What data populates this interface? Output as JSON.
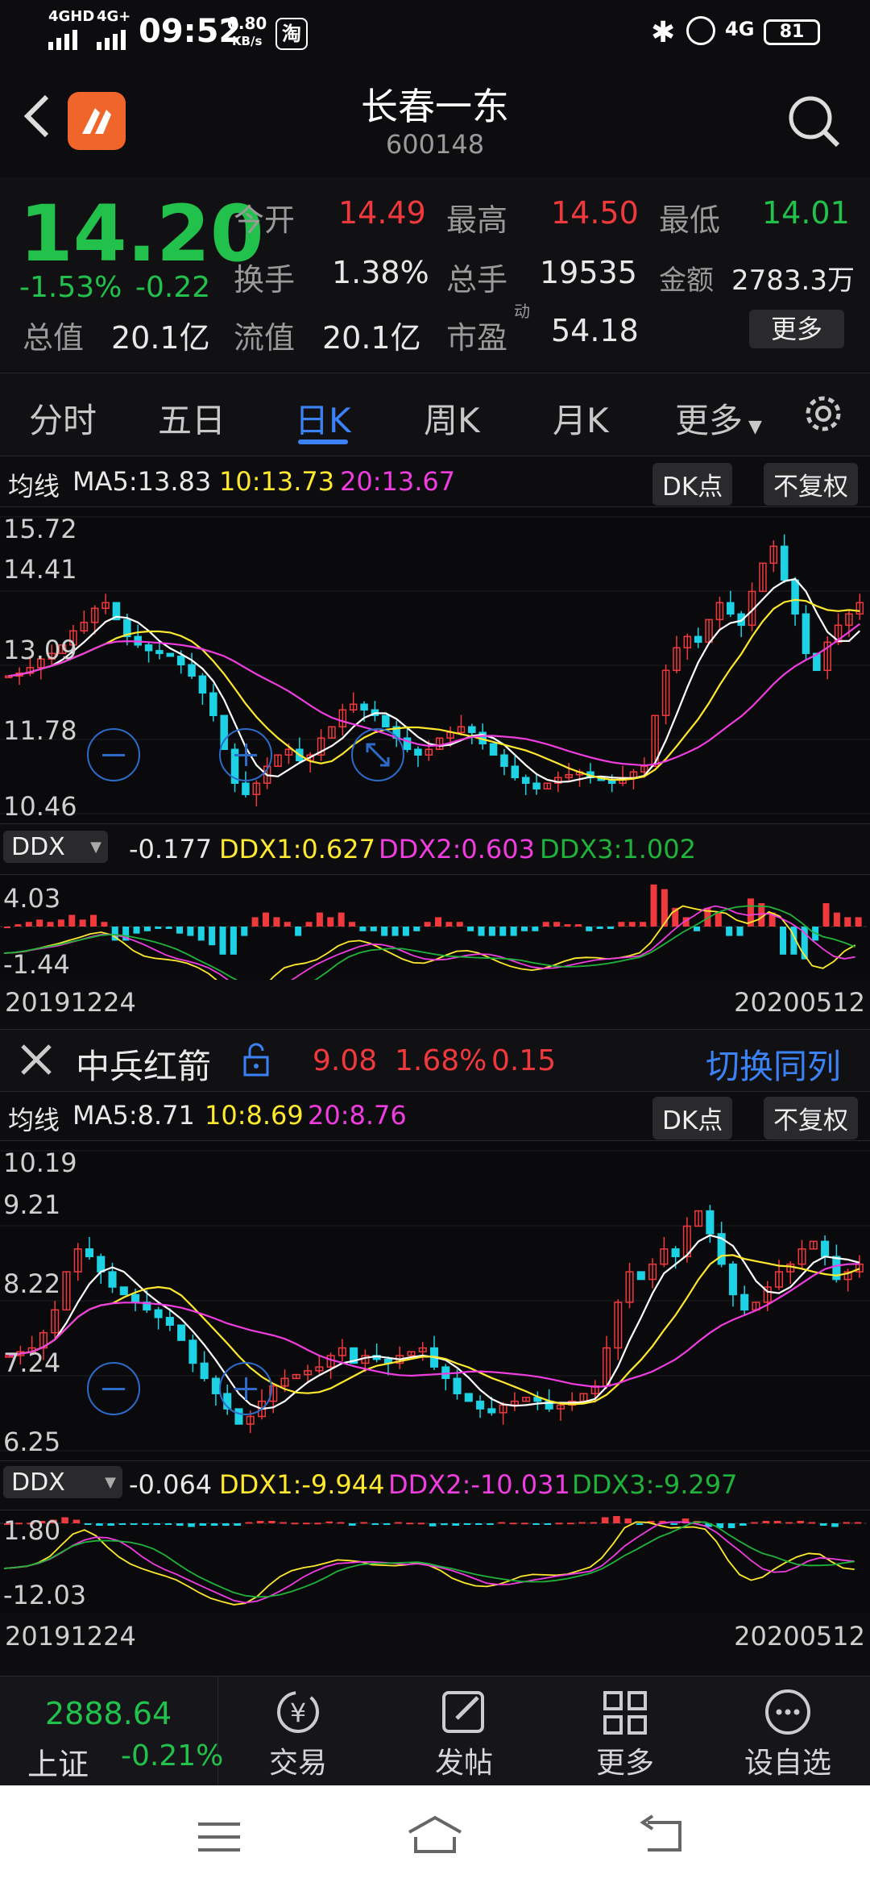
{
  "status_bar": {
    "signal1": "4GHD",
    "signal2": "4G+",
    "time": "09:52",
    "speed": "0.80",
    "speed_unit": "KB/s",
    "taobao": "淘",
    "network": "4G",
    "battery": "81"
  },
  "header": {
    "back_icon": "chevron-left-icon",
    "app_logo": "logo-icon",
    "title": "长春一东",
    "code": "600148",
    "search_icon": "search-icon"
  },
  "quote": {
    "price": "14.20",
    "change_pct": "-1.53%",
    "change": "-0.22",
    "open_label": "今开",
    "open": "14.49",
    "high_label": "最高",
    "high": "14.50",
    "low_label": "最低",
    "low": "14.01",
    "turnover_label": "换手",
    "turnover": "1.38%",
    "volume_label": "总手",
    "volume": "19535",
    "amount_label": "金额",
    "amount": "2783.3万",
    "mcap_label": "总值",
    "mcap": "20.1亿",
    "float_label": "流值",
    "float": "20.1亿",
    "pe_label": "市盈",
    "pe_sup": "动",
    "pe": "54.18",
    "more": "更多"
  },
  "tabs": [
    "分时",
    "五日",
    "日K",
    "周K",
    "月K",
    "更多"
  ],
  "active_tab": 2,
  "chart1": {
    "ma_label": "均线",
    "ma5": "MA5:13.83",
    "ma10": "10:13.73",
    "ma20": "20:13.67",
    "dk": "DK点",
    "adjust": "不复权",
    "y_labels": [
      "15.72",
      "14.41",
      "13.09",
      "11.78",
      "10.46"
    ],
    "ddx_select": "DDX",
    "ddx": "-0.177",
    "ddx1": "DDX1:0.627",
    "ddx2": "DDX2:0.603",
    "ddx3": "DDX3:1.002",
    "ddx_top": "4.03",
    "ddx_bottom": "-1.44",
    "date_start": "20191224",
    "date_end": "20200512"
  },
  "compare": {
    "name": "中兵红箭",
    "price": "9.08",
    "pct": "1.68%",
    "change": "0.15",
    "switch": "切换同列"
  },
  "chart2": {
    "ma_label": "均线",
    "ma5": "MA5:8.71",
    "ma10": "10:8.69",
    "ma20": "20:8.76",
    "dk": "DK点",
    "adjust": "不复权",
    "y_labels": [
      "10.19",
      "9.21",
      "8.22",
      "7.24",
      "6.25"
    ],
    "ddx_select": "DDX",
    "ddx": "-0.064",
    "ddx1": "DDX1:-9.944",
    "ddx2": "DDX2:-10.031",
    "ddx3": "DDX3:-9.297",
    "ddx_top": "1.80",
    "ddx_bottom": "-12.03",
    "date_start": "20191224",
    "date_end": "20200512"
  },
  "bottom_nav": {
    "index_value": "2888.64",
    "index_name": "上证",
    "index_pct": "-0.21%",
    "trade": "交易",
    "post": "发帖",
    "more": "更多",
    "watch": "设自选"
  },
  "colors": {
    "up": "#f0393d",
    "down": "#22c14b",
    "ma5": "#ffffff",
    "ma10": "#ffe92e",
    "ma20": "#ef3de0",
    "accent": "#3b82f6",
    "bar_down": "#1ed2e6"
  },
  "chart_data": [
    {
      "type": "candlestick",
      "title": "长春一东 日K",
      "x_start": "20191224",
      "x_end": "20200512",
      "ylim": [
        10.46,
        15.72
      ],
      "close": [
        12.9,
        12.95,
        13.05,
        13.2,
        13.3,
        13.45,
        13.7,
        13.85,
        14.1,
        14.2,
        13.9,
        13.6,
        13.45,
        13.35,
        13.3,
        13.25,
        13.1,
        12.9,
        12.6,
        12.2,
        11.6,
        11.0,
        10.8,
        11.0,
        11.3,
        11.5,
        11.6,
        11.4,
        11.5,
        11.8,
        12.0,
        12.3,
        12.4,
        12.3,
        12.2,
        12.0,
        11.8,
        11.6,
        11.5,
        11.6,
        11.8,
        11.9,
        12.0,
        11.9,
        11.7,
        11.5,
        11.3,
        11.1,
        11.0,
        10.9,
        11.0,
        11.1,
        11.15,
        11.2,
        11.1,
        11.05,
        11.0,
        11.1,
        11.2,
        11.3,
        12.2,
        13.0,
        13.4,
        13.6,
        13.5,
        13.9,
        14.2,
        14.0,
        13.8,
        14.4,
        14.9,
        15.2,
        14.6,
        14.0,
        13.3,
        13.0,
        13.5,
        13.8,
        14.0,
        14.2
      ],
      "ma5_last": 13.83,
      "ma10_last": 13.73,
      "ma20_last": 13.67
    },
    {
      "type": "candlestick",
      "title": "中兵红箭 日K",
      "x_start": "20191224",
      "x_end": "20200512",
      "ylim": [
        6.25,
        10.19
      ],
      "close": [
        7.5,
        7.55,
        7.6,
        7.8,
        8.1,
        8.6,
        8.9,
        8.8,
        8.6,
        8.4,
        8.3,
        8.2,
        8.1,
        8.0,
        7.9,
        7.7,
        7.4,
        7.2,
        7.0,
        6.8,
        6.6,
        6.7,
        6.9,
        7.1,
        7.2,
        7.25,
        7.3,
        7.35,
        7.5,
        7.6,
        7.4,
        7.5,
        7.45,
        7.4,
        7.5,
        7.55,
        7.6,
        7.35,
        7.2,
        7.0,
        6.9,
        6.8,
        6.75,
        6.85,
        6.9,
        6.95,
        6.9,
        6.8,
        6.85,
        6.9,
        7.0,
        7.1,
        7.6,
        8.2,
        8.6,
        8.5,
        8.7,
        8.9,
        8.8,
        9.2,
        9.4,
        9.1,
        8.7,
        8.3,
        8.1,
        8.2,
        8.4,
        8.6,
        8.7,
        8.9,
        9.0,
        8.8,
        8.5,
        8.6,
        8.7
      ],
      "ma5_last": 8.71,
      "ma10_last": 8.69,
      "ma20_last": 8.76
    }
  ]
}
